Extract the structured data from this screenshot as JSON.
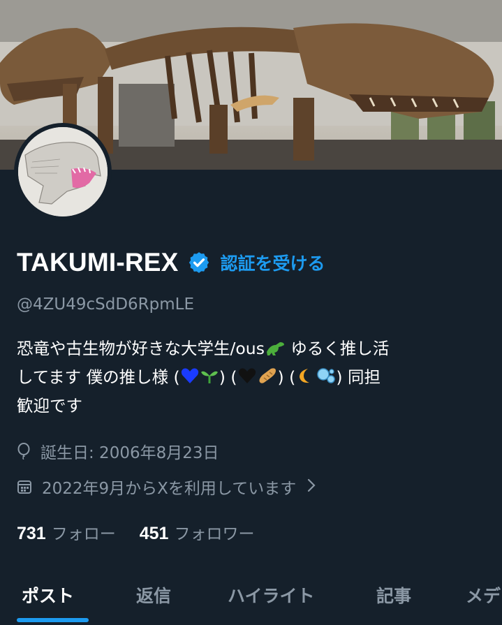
{
  "profile": {
    "display_name": "TAKUMI-REX",
    "verify_link": "認証を受ける",
    "handle": "@4ZU49cSdD6RpmLE",
    "bio": {
      "line1_a": "恐竜や古生物が好きな大学生/ous",
      "line1_b": " ゆるく推し活",
      "line2_a": "してます 僕の推し様 (",
      "line2_b": ") (",
      "line2_c": ") (",
      "line2_d": ") 同担",
      "line3": "歓迎です"
    },
    "birthday": "誕生日: 2006年8月23日",
    "joined": "2022年9月からXを利用しています"
  },
  "stats": {
    "following_count": "731",
    "following_label": "フォロー",
    "followers_count": "451",
    "followers_label": "フォロワー"
  },
  "tabs": [
    {
      "label": "ポスト",
      "active": true
    },
    {
      "label": "返信"
    },
    {
      "label": "ハイライト"
    },
    {
      "label": "記事"
    },
    {
      "label": "メデ"
    }
  ],
  "colors": {
    "background": "#15202b",
    "accent": "#1d9bf0",
    "secondary_text": "#8b98a5"
  },
  "icons": [
    "verified-badge-icon",
    "balloon-icon",
    "calendar-icon",
    "chevron-right-icon"
  ]
}
